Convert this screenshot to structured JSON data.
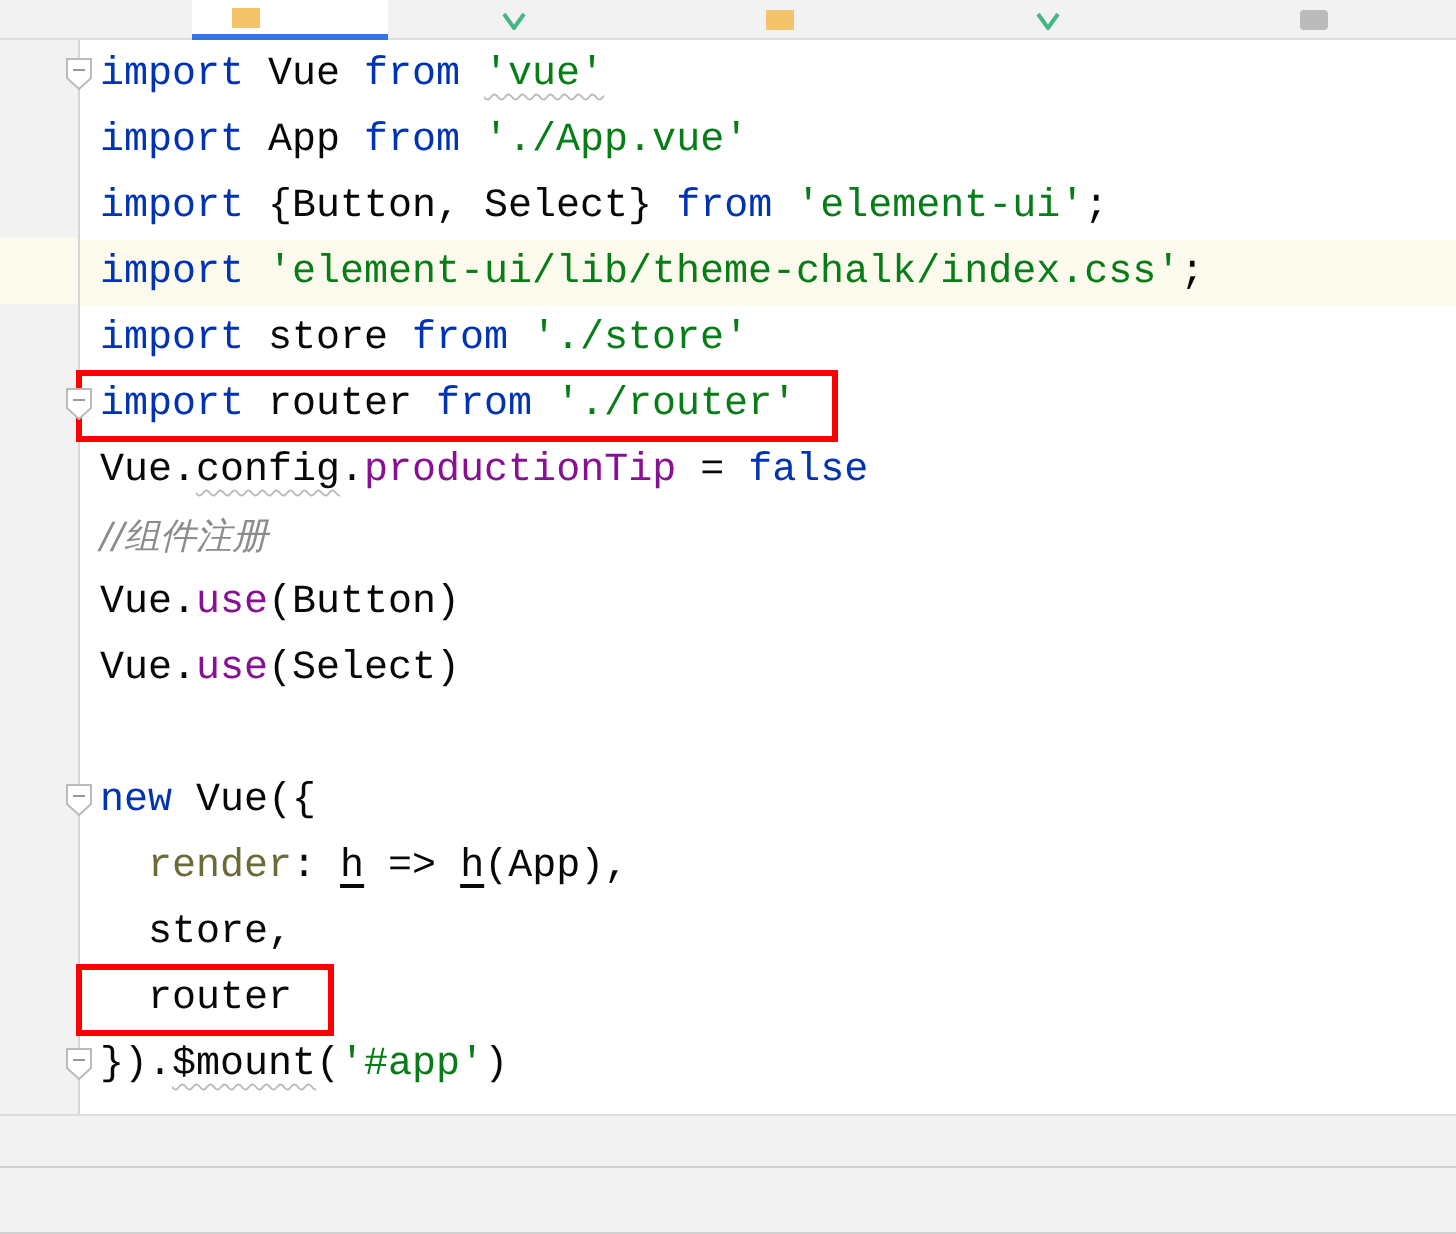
{
  "tabs": [
    {
      "kind": "js",
      "selected": true
    },
    {
      "kind": "vue",
      "selected": false
    },
    {
      "kind": "js",
      "selected": false
    },
    {
      "kind": "vue",
      "selected": false
    },
    {
      "kind": "json",
      "selected": false
    }
  ],
  "lines": [
    {
      "fold": true,
      "tokens": [
        {
          "kind": "kw",
          "text": "import"
        },
        {
          "kind": "plain",
          "text": " Vue "
        },
        {
          "kind": "kw",
          "text": "from "
        },
        {
          "kind": "str",
          "text": "'vue'",
          "wavy": true
        }
      ]
    },
    {
      "tokens": [
        {
          "kind": "kw",
          "text": "import"
        },
        {
          "kind": "plain",
          "text": " App "
        },
        {
          "kind": "kw",
          "text": "from "
        },
        {
          "kind": "str",
          "text": "'./App.vue'"
        }
      ]
    },
    {
      "tokens": [
        {
          "kind": "kw",
          "text": "import"
        },
        {
          "kind": "plain",
          "text": " {Button, Select} "
        },
        {
          "kind": "kw",
          "text": "from "
        },
        {
          "kind": "str",
          "text": "'element-ui'"
        },
        {
          "kind": "plain",
          "text": ";"
        }
      ]
    },
    {
      "highlighted": true,
      "tokens": [
        {
          "kind": "kw",
          "text": "import "
        },
        {
          "kind": "str",
          "text": "'element-ui/lib/theme-chalk/index.css'"
        },
        {
          "kind": "plain",
          "text": ";"
        }
      ]
    },
    {
      "tokens": [
        {
          "kind": "kw",
          "text": "import"
        },
        {
          "kind": "plain",
          "text": " store "
        },
        {
          "kind": "kw",
          "text": "from "
        },
        {
          "kind": "str",
          "text": "'./store'"
        }
      ]
    },
    {
      "fold": true,
      "boxed": true,
      "tokens": [
        {
          "kind": "kw",
          "text": "import"
        },
        {
          "kind": "plain",
          "text": " router "
        },
        {
          "kind": "kw",
          "text": "from "
        },
        {
          "kind": "str",
          "text": "'./router'"
        }
      ]
    },
    {
      "tokens": [
        {
          "kind": "plain",
          "text": "Vue."
        },
        {
          "kind": "plain",
          "text": "config",
          "wavy": true
        },
        {
          "kind": "plain",
          "text": "."
        },
        {
          "kind": "prop",
          "text": "productionTip"
        },
        {
          "kind": "plain",
          "text": " = "
        },
        {
          "kind": "kw",
          "text": "false"
        }
      ]
    },
    {
      "tokens": [
        {
          "kind": "comment",
          "text": "//组件注册"
        }
      ]
    },
    {
      "tokens": [
        {
          "kind": "plain",
          "text": "Vue."
        },
        {
          "kind": "prop",
          "text": "use"
        },
        {
          "kind": "plain",
          "text": "(Button)"
        }
      ]
    },
    {
      "tokens": [
        {
          "kind": "plain",
          "text": "Vue."
        },
        {
          "kind": "prop",
          "text": "use"
        },
        {
          "kind": "plain",
          "text": "(Select)"
        }
      ]
    },
    {
      "blank_before": true,
      "fold": true,
      "tokens": [
        {
          "kind": "kw",
          "text": "new"
        },
        {
          "kind": "plain",
          "text": " Vue({"
        }
      ]
    },
    {
      "tokens": [
        {
          "kind": "param",
          "text": "  render"
        },
        {
          "kind": "plain",
          "text": ": "
        },
        {
          "kind": "plain",
          "text": "h",
          "underlined": true
        },
        {
          "kind": "plain",
          "text": " => "
        },
        {
          "kind": "plain",
          "text": "h",
          "underlined": true
        },
        {
          "kind": "plain",
          "text": "(App),"
        }
      ]
    },
    {
      "tokens": [
        {
          "kind": "plain",
          "text": "  store,"
        }
      ]
    },
    {
      "boxed": true,
      "tokens": [
        {
          "kind": "plain",
          "text": "  router"
        }
      ]
    },
    {
      "fold": true,
      "tokens": [
        {
          "kind": "plain",
          "text": "})."
        },
        {
          "kind": "plain",
          "text": "$mount",
          "wavy": true
        },
        {
          "kind": "plain",
          "text": "("
        },
        {
          "kind": "str",
          "text": "'#app'"
        },
        {
          "kind": "plain",
          "text": ")"
        }
      ]
    }
  ]
}
